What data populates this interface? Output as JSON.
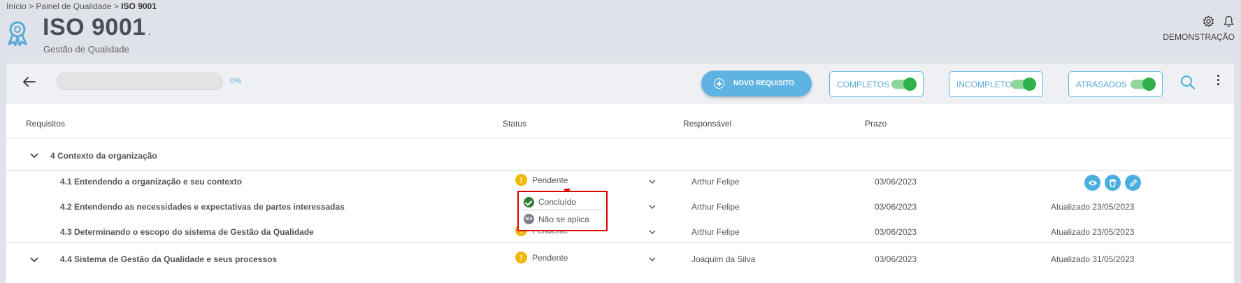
{
  "breadcrumb": {
    "home": "Início",
    "sep1": ">",
    "section": "Painel de Qualidade",
    "sep2": ">",
    "current": "ISO 9001"
  },
  "header": {
    "title": "ISO 9001",
    "title_dot": ".",
    "subtitle": "Gestão de Qualidade",
    "user": "DEMONSTRAÇÃO"
  },
  "toolbar": {
    "progress": {
      "value": 0,
      "label": "0%"
    },
    "new_button": "NOVO REQUISITO",
    "filters": [
      {
        "label": "COMPLETOS",
        "enabled": true
      },
      {
        "label": "INCOMPLETOS",
        "enabled": true
      },
      {
        "label": "ATRASADOS",
        "enabled": true
      }
    ]
  },
  "table": {
    "headers": {
      "requirement": "Requisitos",
      "status": "Status",
      "owner": "Responsável",
      "deadline": "Prazo"
    },
    "group": {
      "label": "4 Contexto da organização"
    },
    "rows": [
      {
        "requirement": "4.1 Entendendo a organização e seu contexto",
        "status": "Pendente",
        "owner": "Arthur Felipe",
        "deadline": "03/06/2023",
        "updated": ""
      },
      {
        "requirement": "4.2 Entendendo as necessidades e expectativas de partes interessadas",
        "status": "",
        "owner": "Arthur Felipe",
        "deadline": "03/06/2023",
        "updated": "Atualizado 23/05/2023"
      },
      {
        "requirement": "4.3 Determinando o escopo do sistema de Gestão da Qualidade",
        "status": "Pendente",
        "owner": "Arthur Felipe",
        "deadline": "03/06/2023",
        "updated": "Atualizado 23/05/2023"
      },
      {
        "requirement": "4.4 Sistema de Gestão da Qualidade e seus processos",
        "status": "Pendente",
        "owner": "Joaquim da Silva",
        "deadline": "03/06/2023",
        "updated": "Atualizado 31/05/2023"
      }
    ]
  },
  "status_dropdown": {
    "options": [
      {
        "label": "Concluído",
        "icon": "check-circle-icon"
      },
      {
        "label": "Não se aplica",
        "icon": "na-icon",
        "icon_text": "N/A"
      }
    ]
  },
  "colors": {
    "accent": "#5fb3e2",
    "toggle_on": "#2fb04a",
    "pending": "#f2b705",
    "highlight": "#e00000"
  }
}
